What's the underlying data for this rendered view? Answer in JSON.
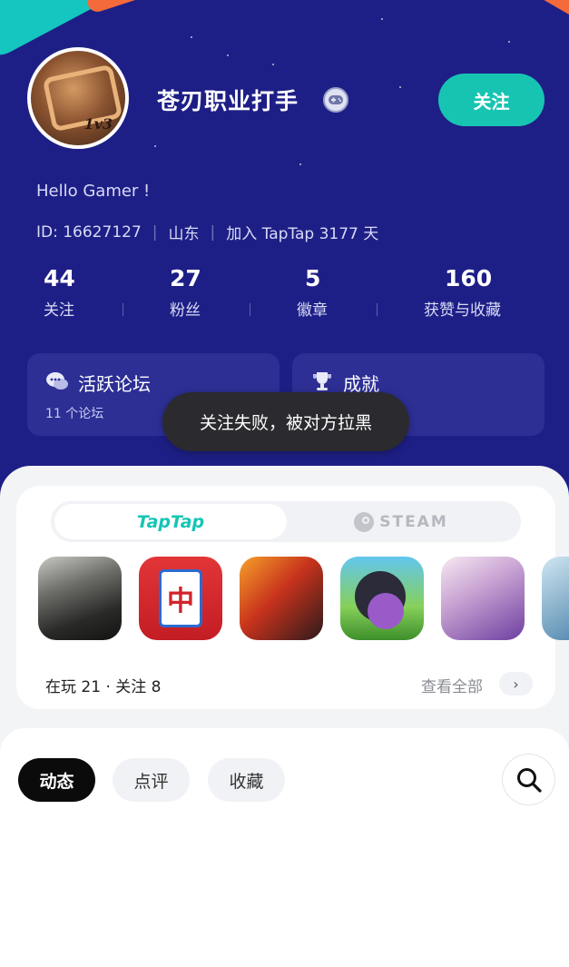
{
  "profile": {
    "username": "苍刃职业打手",
    "avatar_text": "1v3",
    "follow_button": "关注",
    "greeting": "Hello Gamer !",
    "id_text": "ID: 16627127",
    "location": "山东",
    "joined_text": "加入 TapTap 3177 天"
  },
  "stats": [
    {
      "value": "44",
      "label": "关注"
    },
    {
      "value": "27",
      "label": "粉丝"
    },
    {
      "value": "5",
      "label": "徽章"
    },
    {
      "value": "160",
      "label": "获赞与收藏"
    }
  ],
  "cards": {
    "forum": {
      "title": "活跃论坛",
      "subtitle": "11 个论坛",
      "icon": "chat-bubbles-icon"
    },
    "achievements": {
      "title": "成就",
      "icon": "trophy-icon"
    }
  },
  "toast": {
    "message": "关注失败，被对方拉黑"
  },
  "platform_tabs": {
    "taptap": "TapTap",
    "steam": "STEAM",
    "selected": "TapTap"
  },
  "games": {
    "mahjong_glyph": "中",
    "summary": "在玩 21 · 关注 8",
    "view_all": "查看全部"
  },
  "feed_tabs": [
    {
      "label": "动态",
      "active": true
    },
    {
      "label": "点评",
      "active": false
    },
    {
      "label": "收藏",
      "active": false
    }
  ],
  "colors": {
    "header_bg": "#1e1f86",
    "accent_teal": "#17c4b2",
    "toast_bg": "#2a2a2f"
  }
}
